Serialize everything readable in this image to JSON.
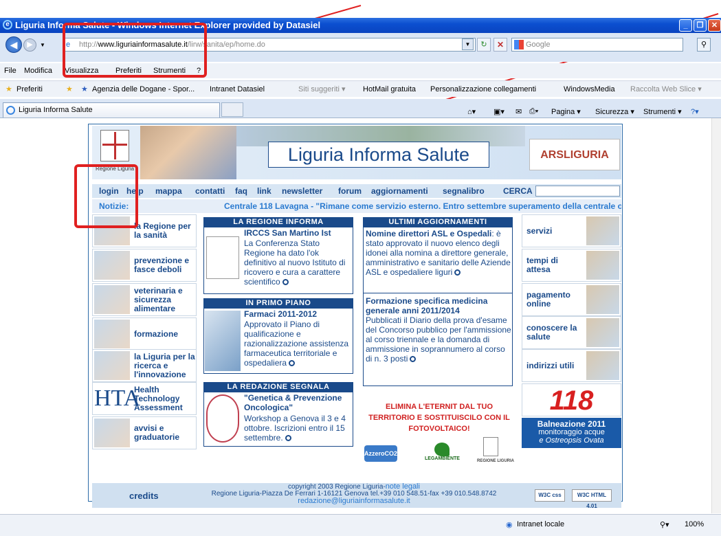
{
  "window": {
    "title": "Liguria Informa Salute - Windows Internet Explorer provided by Datasiel"
  },
  "address": {
    "url_prefix": "http://",
    "url_host": "www.liguriainformasalute.it",
    "url_path": "/lirw/sanita/ep/home.do",
    "search_placeholder": "Google"
  },
  "menu": [
    "File",
    "Modifica",
    "Visualizza",
    "Preferiti",
    "Strumenti",
    "?"
  ],
  "favorites": {
    "label": "Preferiti",
    "items": [
      "Agenzia delle Dogane - Spor...",
      "Intranet Datasiel",
      "Siti suggeriti ▾",
      "HotMail gratuita",
      "Personalizzazione collegamenti",
      "WindowsMedia",
      "Raccolta Web Slice ▾"
    ]
  },
  "tab": {
    "label": "Liguria Informa Salute"
  },
  "commands": [
    "Pagina ▾",
    "Sicurezza ▾",
    "Strumenti ▾"
  ],
  "site": {
    "region_label": "Regione Liguria",
    "title": "Liguria Informa Salute",
    "ars": "ARSLIGURIA",
    "nav": [
      "login",
      "help",
      "mappa",
      "contatti",
      "faq",
      "link",
      "newsletter",
      "forum",
      "aggiornamenti",
      "segnalibro",
      "CERCA"
    ],
    "news_label": "Notizie:",
    "news_ticker": "Centrale 118 Lavagna - \"Rimane come servizio esterno. Entro settembre superamento della centrale o",
    "left": [
      "la Regione per la sanità",
      "prevenzione e fasce deboli",
      "veterinaria e sicurezza alimentare",
      "formazione",
      "la Liguria per la ricerca e l'innovazione",
      "Health Technology Assessment",
      "avvisi e graduatorie"
    ],
    "regione_informa": {
      "header": "LA REGIONE INFORMA",
      "title": "IRCCS San Martino Ist",
      "text": "La Conferenza Stato Regione ha dato l'ok definitivo al nuovo Istituto di ricovero e cura a carattere scientifico"
    },
    "primo_piano": {
      "header": "IN PRIMO PIANO",
      "title": "Farmaci 2011-2012",
      "text": "Approvato il Piano di qualificazione e razionalizzazione assistenza farmaceutica territoriale e ospedaliera"
    },
    "redazione": {
      "header": "LA REDAZIONE SEGNALA",
      "title": "\"Genetica & Prevenzione Oncologica\"",
      "text": "Workshop a Genova il 3 e 4 ottobre. Iscrizioni entro il 15 settembre."
    },
    "ultimi": {
      "header": "ULTIMI AGGIORNAMENTI",
      "title1": "Nomine direttori ASL e Ospedali",
      "text1": ": è stato approvato il nuovo elenco degli idonei alla nomina a direttore generale, amministrativo e sanitario delle Aziende ASL e ospedaliere liguri",
      "title2": "Formazione specifica medicina generale anni 2011/2014",
      "text2": "Pubblicati il Diario della prova d'esame del Concorso pubblico per l'ammissione al corso triennale e la domanda di ammissione in soprannumero al corso di n. 3 posti"
    },
    "eternit": "ELIMINA L'ETERNIT DAL TUO TERRITORIO E SOSTITUISCILO CON IL FOTOVOLTAICO!",
    "logos": [
      "AzzeroCO2",
      "LEGAMBIENTE",
      "REGIONE LIGURIA"
    ],
    "right": [
      "servizi",
      "tempi di attesa",
      "pagamento online",
      "conoscere la salute",
      "indirizzi utili"
    ],
    "emergency": "118",
    "balneazione": {
      "title": "Balneazione 2011",
      "line1": "monitoraggio acque",
      "line2": "e Ostreopsis Ovata"
    },
    "footer": {
      "credits": "credits",
      "copyright": "copyright 2003 Regione Liguria-",
      "note": "note legali",
      "address": "Regione Liguria-Piazza De Ferrari 1-16121 Genova tel.+39 010 548.51-fax +39 010.548.8742",
      "email": "redazione@liguriainformasalute.it",
      "w3c1": "W3C css",
      "w3c2": "W3C HTML 4.01"
    }
  },
  "status": {
    "zone": "Intranet locale",
    "zoom": "100%"
  },
  "colors": {
    "ie_blue": "#0b4fd0",
    "site_blue": "#1a4a8a",
    "annotation_red": "#e02020"
  }
}
